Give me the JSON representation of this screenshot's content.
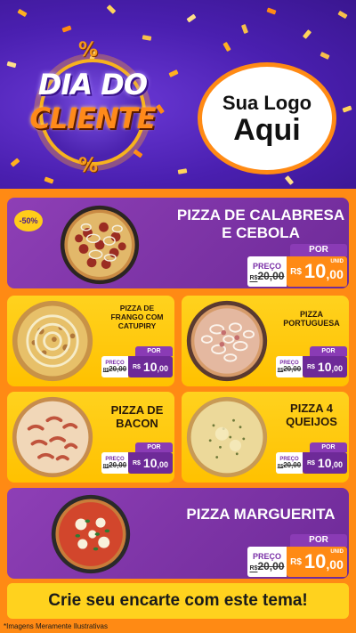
{
  "header": {
    "badge_line1": "DIA DO",
    "badge_line2": "CLIENTE",
    "percent_symbol": "%",
    "logo_line1": "Sua Logo",
    "logo_line2": "Aqui"
  },
  "colors": {
    "header_bg": "#4a1fb0",
    "orange": "#ff8a14",
    "purple": "#7a2fa7",
    "yellow": "#ffc100"
  },
  "products": [
    {
      "name_line1": "PIZZA DE CALABRESA",
      "name_line2": "E CEBOLA",
      "discount": "-50%",
      "por": "POR",
      "preco_label": "PREÇO",
      "old_price": "20,00",
      "old_prefix": "R$",
      "currency": "R$",
      "price_int": "10",
      "price_cents": ",00",
      "unit": "UNID"
    },
    {
      "name_line1": "PIZZA DE",
      "name_line2": "FRANGO COM",
      "name_line3": "CATUPIRY",
      "por": "POR",
      "preco_label": "PREÇO",
      "old_price": "20,00",
      "old_prefix": "R$",
      "currency": "R$",
      "price_int": "10",
      "price_cents": ",00"
    },
    {
      "name_line1": "PIZZA",
      "name_line2": "PORTUGUESA",
      "por": "POR",
      "preco_label": "PREÇO",
      "old_price": "20,00",
      "old_prefix": "R$",
      "currency": "R$",
      "price_int": "10",
      "price_cents": ",00"
    },
    {
      "name_line1": "PIZZA DE",
      "name_line2": "BACON",
      "por": "POR",
      "preco_label": "PREÇO",
      "old_price": "20,00",
      "old_prefix": "R$",
      "currency": "R$",
      "price_int": "10",
      "price_cents": ",00"
    },
    {
      "name_line1": "PIZZA 4",
      "name_line2": "QUEIJOS",
      "por": "POR",
      "preco_label": "PREÇO",
      "old_price": "20,00",
      "old_prefix": "R$",
      "currency": "R$",
      "price_int": "10",
      "price_cents": ",00"
    },
    {
      "name_line1": "PIZZA MARGUERITA",
      "por": "POR",
      "preco_label": "PREÇO",
      "old_price": "20,00",
      "old_prefix": "R$",
      "currency": "R$",
      "price_int": "10",
      "price_cents": ",00",
      "unit": "UNID"
    }
  ],
  "footer": {
    "cta": "Crie seu encarte com este tema!",
    "note": "*Imagens Meramente Ilustrativas"
  }
}
